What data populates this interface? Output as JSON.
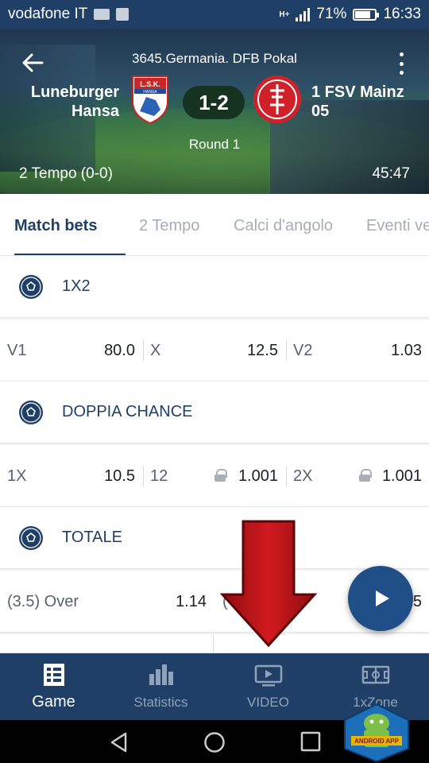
{
  "status_bar": {
    "carrier": "vodafone IT",
    "signal_type": "H+",
    "battery": "71%",
    "battery_level": 0.71,
    "time": "16:33"
  },
  "match": {
    "league": "3645.Germania. DFB Pokal",
    "home_team_line1": "Luneburger",
    "home_team_line2": "Hansa",
    "home_crest_text": "L.S.K.",
    "home_crest_subtext": "HANSA",
    "away_team_line1": "1 FSV Mainz",
    "away_team_line2": "05",
    "score": "1-2",
    "round": "Round 1",
    "period": "2 Tempo (0-0)",
    "clock": "45:47"
  },
  "tabs": [
    {
      "label": "Match bets",
      "active": true
    },
    {
      "label": "2 Tempo"
    },
    {
      "label": "Calci d'angolo"
    },
    {
      "label": "Eventi ve"
    }
  ],
  "markets": [
    {
      "title": "1X2",
      "rows": [
        [
          "V1",
          "80.0",
          "X",
          "12.5",
          "V2",
          "1.03"
        ]
      ]
    },
    {
      "title": "DOPPIA CHANCE",
      "rows": [
        [
          "1X",
          "10.5",
          "12",
          "1.001",
          "2X",
          "1.001"
        ]
      ]
    },
    {
      "title": "TOTALE",
      "rows": [
        [
          "(3.5) Over",
          "1.14",
          "(",
          "",
          "",
          "5"
        ]
      ]
    }
  ],
  "bottom_nav": [
    {
      "label": "Game",
      "icon": "game-icon",
      "active": true
    },
    {
      "label": "Statistics",
      "icon": "statistics-icon"
    },
    {
      "label": "VIDEO",
      "icon": "video-icon"
    },
    {
      "label": "1xZone",
      "icon": "field-icon"
    }
  ],
  "badge": {
    "text": "ANDROID APP"
  },
  "colors": {
    "primary": "#1f3f66",
    "fab": "#1f4f86",
    "arrow": "#c0161a",
    "away_crest": "#d0202a"
  }
}
